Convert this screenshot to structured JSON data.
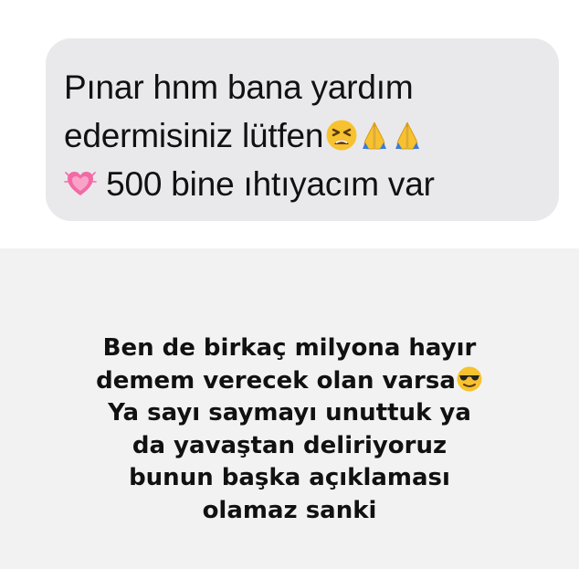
{
  "message": {
    "line1": "Pınar hnm bana yardım",
    "line2": "edermisiniz lütfen",
    "line3": "500 bine ıhtıyacım var",
    "emojis": [
      "tired-face-emoji",
      "folded-hands-emoji",
      "folded-hands-emoji",
      "growing-heart-emoji"
    ]
  },
  "caption": {
    "lines": [
      "Ben de birkaç milyona hayır",
      "demem verecek olan varsa",
      "Ya sayı saymayı unuttuk ya",
      "da yavaştan deliriyoruz",
      "bunun başka açıklaması",
      "olamaz sanki"
    ],
    "emoji": "sunglasses-face-emoji"
  },
  "colors": {
    "background": "#f2f2f2",
    "bubble": "#e9e9eb",
    "text": "#111111",
    "emoji_yellow": "#f7c22f",
    "emoji_pink": "#f26aa5"
  }
}
